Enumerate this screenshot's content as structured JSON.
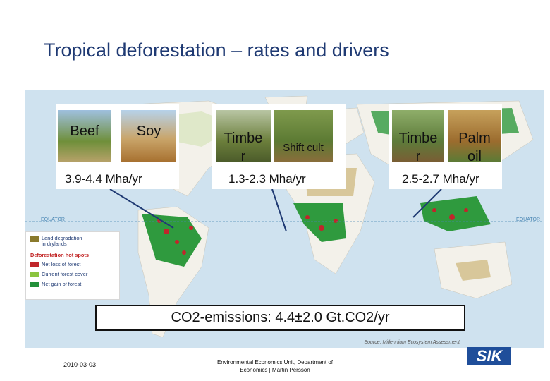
{
  "slide": {
    "title": "Tropical deforestation – rates and drivers",
    "footer_date": "2010-03-03",
    "footer_org_line1": "Environmental Economics Unit, Department of",
    "footer_org_line2": "Economics  |  Martin Persson",
    "logo_text": "SIK"
  },
  "map": {
    "equator_label": "EQUATOR",
    "source": "Source: Millennium Ecosystem Assessment",
    "legend": {
      "land_degradation": "Land degradation",
      "land_degradation_2": "in drylands",
      "hotspots_heading": "Deforestation hot spots",
      "net_loss": "Net loss of forest",
      "current_cover": "Current forest cover",
      "net_gain": "Net gain of forest",
      "colors": {
        "degradation": "#8a7a2c",
        "loss": "#c0262b",
        "cover": "#8bc43f",
        "gain": "#23903a"
      }
    }
  },
  "drivers": {
    "latin_america": {
      "photo1": "Beef",
      "photo2": "Soy",
      "rate": "3.9-4.4 Mha/yr"
    },
    "africa": {
      "photo1_line1": "Timbe",
      "photo1_line2": "r",
      "photo2": "Shift cult",
      "rate": "1.3-2.3 Mha/yr"
    },
    "asia": {
      "photo1_line1": "Timbe",
      "photo1_line2": "r",
      "photo2_line1": "Palm",
      "photo2_line2": "oil",
      "rate": "2.5-2.7 Mha/yr"
    }
  },
  "emissions": "CO2-emissions: 4.4±2.0 Gt.CO2/yr"
}
